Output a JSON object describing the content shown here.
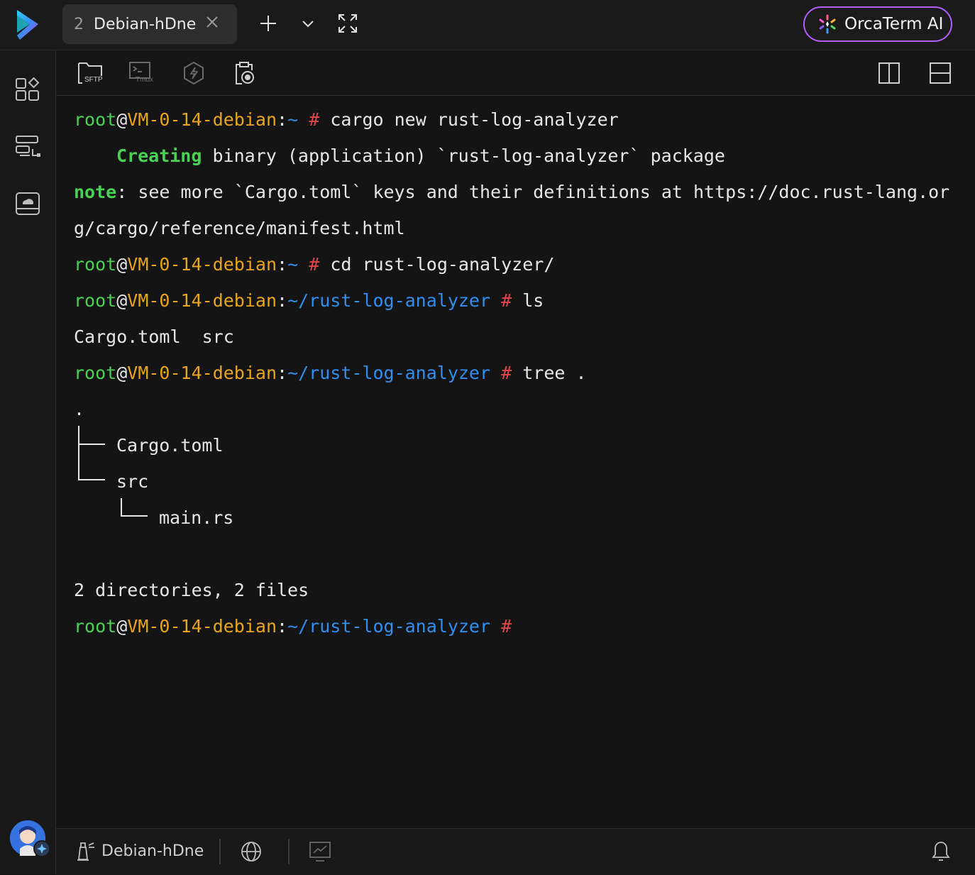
{
  "tabs": [
    {
      "index": "2",
      "title": "Debian-hDne"
    }
  ],
  "ai_button": {
    "label": "OrcaTerm AI"
  },
  "toolbar": {
    "sftp_label": "SFTP",
    "tmux_label": "Tmux"
  },
  "terminal": {
    "prompt_user": "root",
    "prompt_at": "@",
    "prompt_host": "VM-0-14-debian",
    "prompt_colon": ":",
    "home_path": "~",
    "project_path": "~/rust-log-analyzer",
    "hash": "#",
    "cmd1": "cargo new rust-log-analyzer",
    "creating_word": "Creating",
    "creating_rest": "binary (application) `rust-log-analyzer` package",
    "note_word": "note",
    "note_rest": ": see more `Cargo.toml` keys and their definitions at https://doc.rust-lang.or",
    "note_cont": "g/cargo/reference/manifest.html",
    "cmd2": "cd rust-log-analyzer/",
    "cmd3": "ls",
    "ls_output": "Cargo.toml  src",
    "cmd4": "tree .",
    "tree_root": ".",
    "tree_item1": "Cargo.toml",
    "tree_item2": "src",
    "tree_item3": "main.rs",
    "tree_summary": "2 directories, 2 files"
  },
  "statusbar": {
    "session_name": "Debian-hDne"
  },
  "colors": {
    "prompt_green": "#4ad153",
    "host_orange": "#e9a41a",
    "path_blue": "#2f8ef0",
    "hash_red": "#e0464a",
    "ai_border": "#b45cff"
  }
}
